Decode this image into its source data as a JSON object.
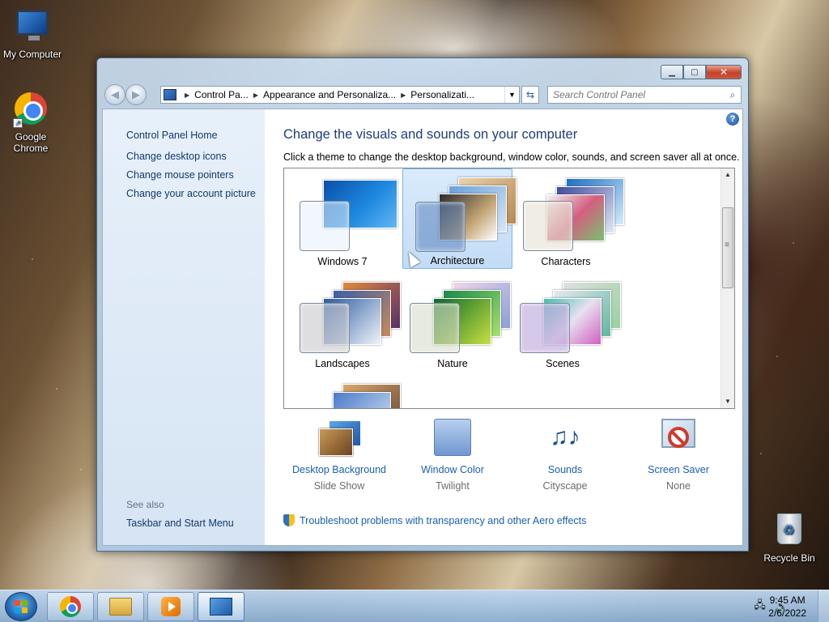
{
  "desktop": {
    "icons": [
      {
        "label": "My Computer"
      },
      {
        "label": "Google Chrome"
      },
      {
        "label": "Recycle Bin"
      }
    ]
  },
  "window": {
    "breadcrumbs": [
      "Control Pa...",
      "Appearance and Personaliza...",
      "Personalizati..."
    ],
    "search_placeholder": "Search Control Panel",
    "controls": {
      "minimize": "minimize",
      "maximize": "maximize",
      "close": "close"
    }
  },
  "left_pane": {
    "home": "Control Panel Home",
    "links": [
      "Change desktop icons",
      "Change mouse pointers",
      "Change your account picture"
    ],
    "see_also_label": "See also",
    "see_also_links": [
      "Taskbar and Start Menu"
    ]
  },
  "main": {
    "help_label": "?",
    "heading": "Change the visuals and sounds on your computer",
    "subheading": "Click a theme to change the desktop background, window color, sounds, and screen saver all at once.",
    "themes": [
      {
        "label": "Windows 7",
        "selected": false
      },
      {
        "label": "Architecture",
        "selected": true
      },
      {
        "label": "Characters",
        "selected": false
      },
      {
        "label": "Landscapes",
        "selected": false
      },
      {
        "label": "Nature",
        "selected": false
      },
      {
        "label": "Scenes",
        "selected": false
      }
    ],
    "settings": [
      {
        "name": "Desktop Background",
        "value": "Slide Show",
        "icon": "desktop-background-icon"
      },
      {
        "name": "Window Color",
        "value": "Twilight",
        "icon": "window-color-icon"
      },
      {
        "name": "Sounds",
        "value": "Cityscape",
        "icon": "sounds-icon"
      },
      {
        "name": "Screen Saver",
        "value": "None",
        "icon": "screen-saver-icon"
      }
    ],
    "troubleshoot": "Troubleshoot problems with transparency and other Aero effects"
  },
  "taskbar": {
    "apps": [
      "chrome",
      "windows-explorer",
      "media-player",
      "control-panel"
    ],
    "clock": {
      "time": "9:45 AM",
      "date": "2/6/2022"
    }
  },
  "colors": {
    "link": "#1a5fb4",
    "heading": "#1e3d7a",
    "selected_bg": "#c3dcf6"
  }
}
